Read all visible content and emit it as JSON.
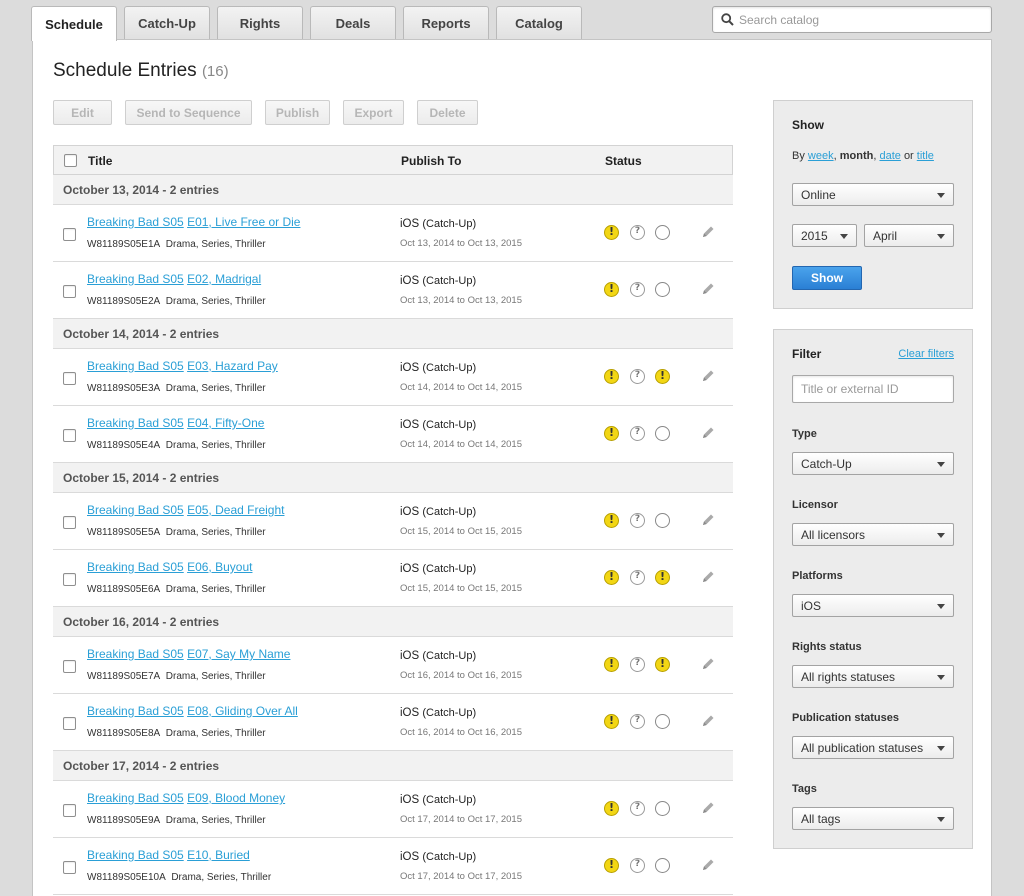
{
  "tabs": [
    {
      "label": "Schedule",
      "active": true
    },
    {
      "label": "Catch-Up"
    },
    {
      "label": "Rights"
    },
    {
      "label": "Deals"
    },
    {
      "label": "Reports"
    },
    {
      "label": "Catalog"
    }
  ],
  "search": {
    "placeholder": "Search catalog",
    "icon": "search-icon"
  },
  "page": {
    "title": "Schedule Entries",
    "count": "(16)"
  },
  "toolbar": {
    "edit": "Edit",
    "send_to_sequence": "Send to Sequence",
    "publish": "Publish",
    "export": "Export",
    "delete": "Delete"
  },
  "table": {
    "headers": {
      "title": "Title",
      "publish_to": "Publish To",
      "status": "Status"
    },
    "groups": [
      {
        "label": "October 13, 2014 - 2 entries",
        "rows": [
          {
            "series": "Breaking Bad S05",
            "episode": "E01, Live Free or Die",
            "id": "W81189S05E1A",
            "genres": "Drama, Series, Thriller",
            "platform": "iOS",
            "service": "(Catch-Up)",
            "dates": "Oct 13, 2014 to Oct 13, 2015",
            "status": [
              "warning",
              "unknown",
              "empty"
            ]
          },
          {
            "series": "Breaking Bad S05",
            "episode": "E02, Madrigal",
            "id": "W81189S05E2A",
            "genres": "Drama, Series, Thriller",
            "platform": "iOS",
            "service": "(Catch-Up)",
            "dates": "Oct 13, 2014 to Oct 13, 2015",
            "status": [
              "warning",
              "unknown",
              "empty"
            ]
          }
        ]
      },
      {
        "label": "October 14, 2014 - 2 entries",
        "rows": [
          {
            "series": "Breaking Bad S05",
            "episode": "E03, Hazard Pay",
            "id": "W81189S05E3A",
            "genres": "Drama, Series, Thriller",
            "platform": "iOS",
            "service": "(Catch-Up)",
            "dates": "Oct 14, 2014 to Oct 14, 2015",
            "status": [
              "warning",
              "unknown",
              "warning"
            ]
          },
          {
            "series": "Breaking Bad S05",
            "episode": "E04, Fifty-One",
            "id": "W81189S05E4A",
            "genres": "Drama, Series, Thriller",
            "platform": "iOS",
            "service": "(Catch-Up)",
            "dates": "Oct 14, 2014 to Oct 14, 2015",
            "status": [
              "warning",
              "unknown",
              "empty"
            ]
          }
        ]
      },
      {
        "label": "October 15, 2014 - 2 entries",
        "rows": [
          {
            "series": "Breaking Bad S05",
            "episode": "E05, Dead Freight",
            "id": "W81189S05E5A",
            "genres": "Drama, Series, Thriller",
            "platform": "iOS",
            "service": "(Catch-Up)",
            "dates": "Oct 15, 2014 to Oct 15, 2015",
            "status": [
              "warning",
              "unknown",
              "empty"
            ]
          },
          {
            "series": "Breaking Bad S05",
            "episode": "E06, Buyout",
            "id": "W81189S05E6A",
            "genres": "Drama, Series, Thriller",
            "platform": "iOS",
            "service": "(Catch-Up)",
            "dates": "Oct 15, 2014 to Oct 15, 2015",
            "status": [
              "warning",
              "unknown",
              "warning"
            ]
          }
        ]
      },
      {
        "label": "October 16, 2014 - 2 entries",
        "rows": [
          {
            "series": "Breaking Bad S05",
            "episode": "E07, Say My Name",
            "id": "W81189S05E7A",
            "genres": "Drama, Series, Thriller",
            "platform": "iOS",
            "service": "(Catch-Up)",
            "dates": "Oct 16, 2014 to Oct 16, 2015",
            "status": [
              "warning",
              "unknown",
              "warning"
            ]
          },
          {
            "series": "Breaking Bad S05",
            "episode": "E08, Gliding Over All",
            "id": "W81189S05E8A",
            "genres": "Drama, Series, Thriller",
            "platform": "iOS",
            "service": "(Catch-Up)",
            "dates": "Oct 16, 2014 to Oct 16, 2015",
            "status": [
              "warning",
              "unknown",
              "empty"
            ]
          }
        ]
      },
      {
        "label": "October 17, 2014 - 2 entries",
        "rows": [
          {
            "series": "Breaking Bad S05",
            "episode": "E09, Blood Money",
            "id": "W81189S05E9A",
            "genres": "Drama, Series, Thriller",
            "platform": "iOS",
            "service": "(Catch-Up)",
            "dates": "Oct 17, 2014 to Oct 17, 2015",
            "status": [
              "warning",
              "unknown",
              "empty"
            ]
          },
          {
            "series": "Breaking Bad S05",
            "episode": "E10, Buried",
            "id": "W81189S05E10A",
            "genres": "Drama, Series, Thriller",
            "platform": "iOS",
            "service": "(Catch-Up)",
            "dates": "Oct 17, 2014 to Oct 17, 2015",
            "status": [
              "warning",
              "unknown",
              "empty"
            ]
          }
        ]
      }
    ]
  },
  "show_panel": {
    "title": "Show",
    "by_prefix": "By",
    "by_week": "week",
    "by_month": "month",
    "by_date": "date",
    "by_or": "or",
    "by_title": "title",
    "mode": "Online",
    "year": "2015",
    "month": "April",
    "button": "Show"
  },
  "filter_panel": {
    "title": "Filter",
    "clear": "Clear filters",
    "text_placeholder": "Title or external ID",
    "type_label": "Type",
    "type_value": "Catch-Up",
    "licensor_label": "Licensor",
    "licensor_value": "All licensors",
    "platforms_label": "Platforms",
    "platforms_value": "iOS",
    "rights_label": "Rights status",
    "rights_value": "All rights statuses",
    "publication_label": "Publication statuses",
    "publication_value": "All publication statuses",
    "tags_label": "Tags",
    "tags_value": "All tags"
  },
  "colors": {
    "link": "#2a9fd6",
    "primary_button": "#2a7fd4",
    "warning": "#f2d614"
  }
}
